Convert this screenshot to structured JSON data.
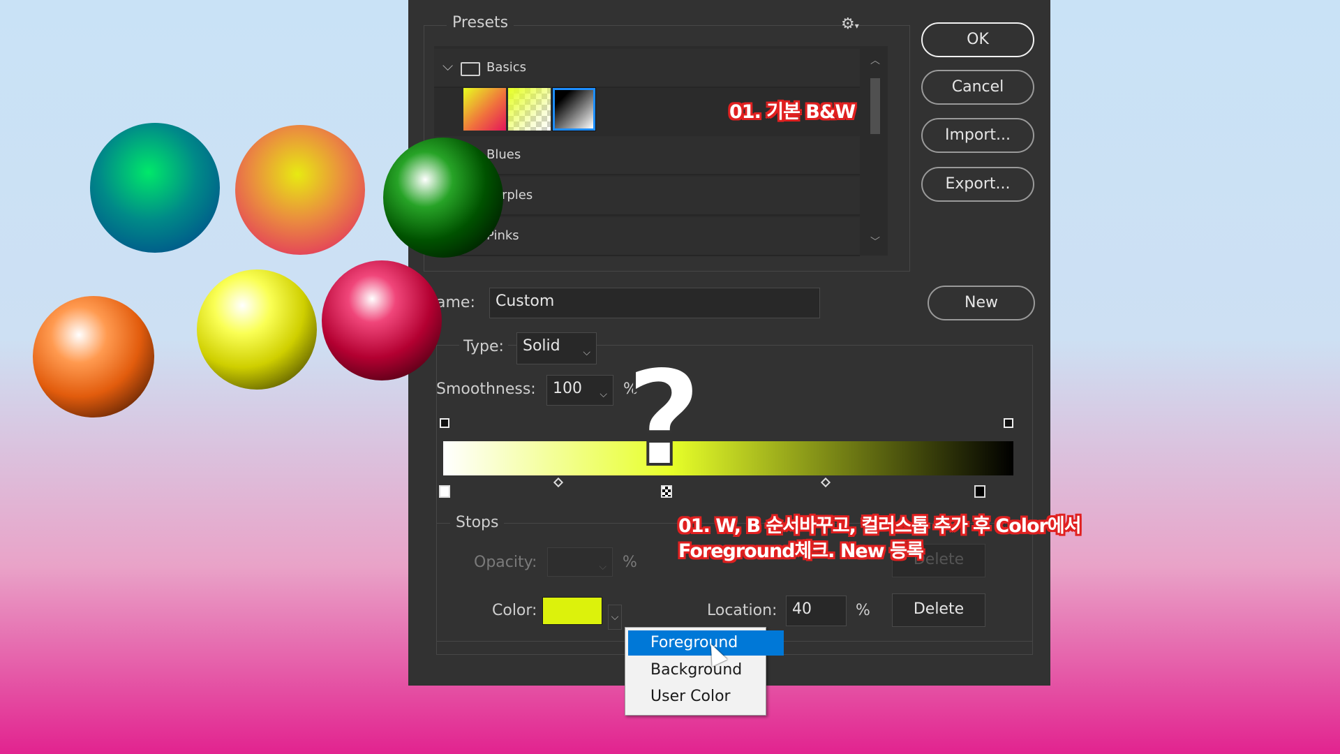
{
  "presets": {
    "title": "Presets",
    "groups": [
      {
        "label": "Basics",
        "expanded": true
      },
      {
        "label": "Blues"
      },
      {
        "label": "Purples"
      },
      {
        "label": "Pinks"
      }
    ]
  },
  "buttons": {
    "ok": "OK",
    "cancel": "Cancel",
    "import": "Import...",
    "export": "Export...",
    "new": "New"
  },
  "name": {
    "label": "ame:",
    "value": "Custom"
  },
  "type": {
    "label": "Type:",
    "value": "Solid"
  },
  "smoothness": {
    "label": "Smoothness:",
    "value": "100",
    "unit": "%"
  },
  "gradient": {
    "colors": [
      "#ffffff",
      "#e7ff29",
      "#000000"
    ],
    "color_stop_locations": [
      0,
      40,
      100
    ]
  },
  "stops": {
    "title": "Stops",
    "opacity_label": "Opacity:",
    "opacity_unit": "%",
    "color_label": "Color:",
    "color_value": "#dcf20c",
    "location_label": "Location:",
    "location_value": "40",
    "location_unit": "%",
    "delete_label": "Delete"
  },
  "color_menu": {
    "items": [
      "Foreground",
      "Background",
      "User Color"
    ],
    "selected": "Foreground"
  },
  "annotations": {
    "note1": "01. 기본 B&W",
    "note2_line1": "01. W, B 순서바꾸고, 컬러스톱 추가 후 Color에서",
    "note2_line2": "Foreground체크.  New 등록",
    "question": "?"
  },
  "colors": {
    "dialog_bg": "#323232",
    "accent": "#0078d7",
    "annotation": "#e02020"
  }
}
